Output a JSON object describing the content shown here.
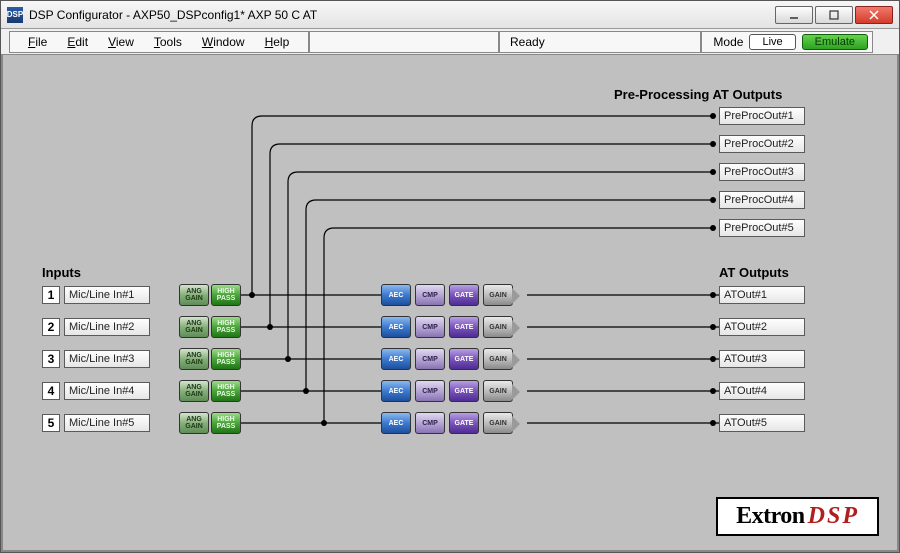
{
  "window": {
    "title": "DSP Configurator - AXP50_DSPconfig1*  AXP 50 C AT",
    "icon_text": "DSP"
  },
  "menu": {
    "items": [
      "File",
      "Edit",
      "View",
      "Tools",
      "Window",
      "Help"
    ],
    "status": "Ready",
    "mode_label": "Mode",
    "live": "Live",
    "emulate": "Emulate"
  },
  "sections": {
    "inputs": "Inputs",
    "preproc": "Pre-Processing AT Outputs",
    "atout": "AT Outputs"
  },
  "inputs": [
    {
      "num": "1",
      "label": "Mic/Line In#1"
    },
    {
      "num": "2",
      "label": "Mic/Line In#2"
    },
    {
      "num": "3",
      "label": "Mic/Line In#3"
    },
    {
      "num": "4",
      "label": "Mic/Line In#4"
    },
    {
      "num": "5",
      "label": "Mic/Line In#5"
    }
  ],
  "preproc_outputs": [
    "PreProcOut#1",
    "PreProcOut#2",
    "PreProcOut#3",
    "PreProcOut#4",
    "PreProcOut#5"
  ],
  "at_outputs": [
    "ATOut#1",
    "ATOut#2",
    "ATOut#3",
    "ATOut#4",
    "ATOut#5"
  ],
  "proc_labels": {
    "ang": "ANG\nGAIN",
    "high": "HIGH\nPASS",
    "aec": "AEC",
    "cmp": "CMP",
    "gate": "GATE",
    "gain": "GAIN"
  },
  "brand": {
    "extron": "Extron",
    "dsp": "DSP"
  }
}
